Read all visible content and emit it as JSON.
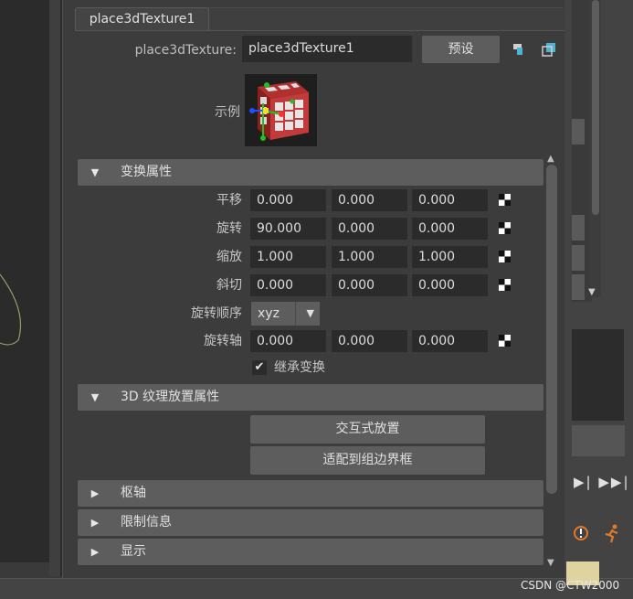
{
  "tab": {
    "label": "place3dTexture1"
  },
  "node": {
    "label": "place3dTexture:",
    "value": "place3dTexture1",
    "preset_label": "预设"
  },
  "sample": {
    "label": "示例"
  },
  "sections": {
    "transform": "变换属性",
    "texture3d": "3D 纹理放置属性",
    "pivot": "枢轴",
    "limits": "限制信息",
    "display": "显示"
  },
  "transform_attrs": {
    "translate": {
      "label": "平移",
      "values": [
        "0.000",
        "0.000",
        "0.000"
      ]
    },
    "rotate": {
      "label": "旋转",
      "values": [
        "90.000",
        "0.000",
        "0.000"
      ]
    },
    "scale": {
      "label": "缩放",
      "values": [
        "1.000",
        "1.000",
        "1.000"
      ]
    },
    "shear": {
      "label": "斜切",
      "values": [
        "0.000",
        "0.000",
        "0.000"
      ]
    },
    "rotate_order": {
      "label": "旋转顺序",
      "value": "xyz"
    },
    "rotate_axis": {
      "label": "旋转轴",
      "values": [
        "0.000",
        "0.000",
        "0.000"
      ]
    },
    "inherit": {
      "label": "继承变换",
      "checked": true
    }
  },
  "texture_buttons": {
    "interactive": "交互式放置",
    "fit_bbox": "适配到组边界框"
  },
  "watermark": "CSDN @CTW2000",
  "icons": {
    "map_button": "checker-map-icon",
    "toolbar1": "copy-tab-icon",
    "toolbar2": "pin-icon"
  },
  "colors": {
    "panel": "#3c3c3c",
    "field": "#2b2b2b",
    "button": "#5d5d5d",
    "section": "#5d5d5d"
  }
}
